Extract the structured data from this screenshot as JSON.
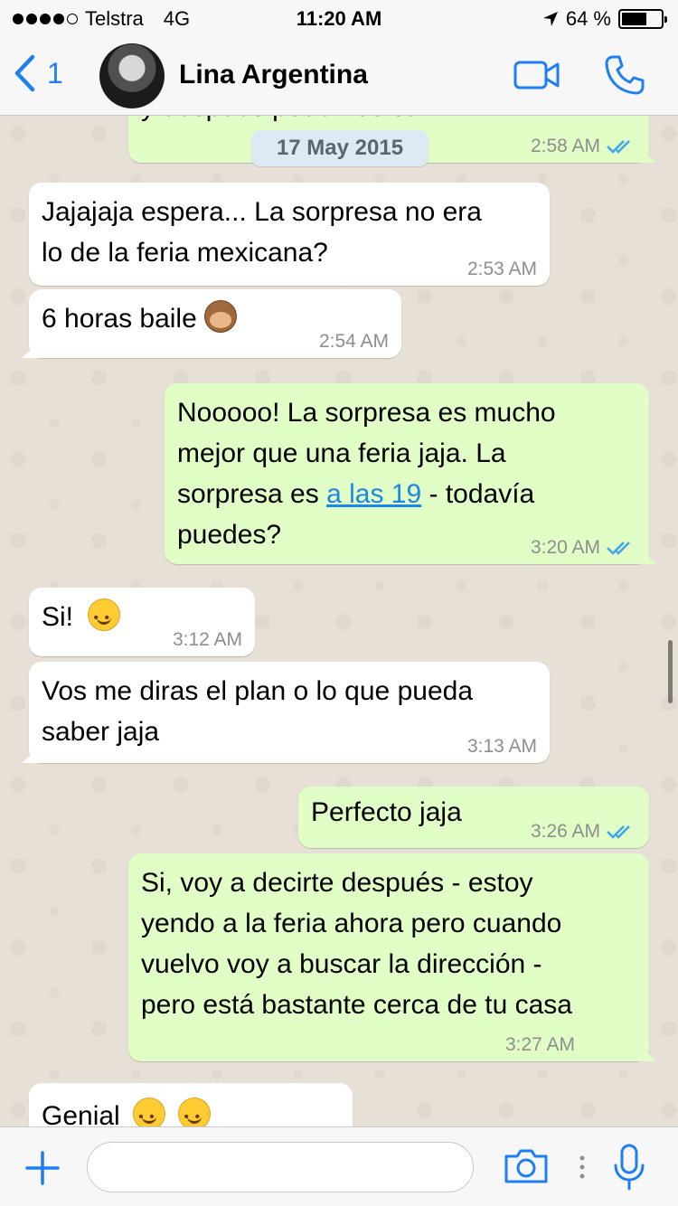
{
  "status_bar": {
    "carrier": "Telstra",
    "network": "4G",
    "time": "11:20 AM",
    "battery": "64 %",
    "battery_level": 0.64
  },
  "header": {
    "back_count": "1",
    "contact_name": "Lina Argentina",
    "icons": [
      "back-chevron-icon",
      "avatar",
      "video-camera-icon",
      "phone-icon"
    ]
  },
  "chat": {
    "date_pill": "17 May 2015",
    "messages": [
      {
        "direction": "out",
        "text": "y despues podemos salir",
        "time": "2:58 AM",
        "read": true
      },
      {
        "direction": "in",
        "lines": [
          "Jajajaja espera... La sorpresa no era",
          "lo de la feria mexicana?"
        ],
        "time": "2:53 AM"
      },
      {
        "direction": "in",
        "text": "6 horas baile",
        "emoji": "see-no-evil-monkey",
        "time": "2:54 AM"
      },
      {
        "direction": "out",
        "lines": [
          "Nooooo! La sorpresa es mucho",
          "mejor que una feria jaja. La"
        ],
        "line3_before": "sorpresa es ",
        "line3_link": "a las 19",
        "line3_after": " - todavía",
        "line4": "puedes?",
        "time": "3:20 AM",
        "read": true
      },
      {
        "direction": "in",
        "text": "Si!",
        "emoji": "smiling-face",
        "time": "3:12 AM"
      },
      {
        "direction": "in",
        "lines": [
          "Vos me diras el plan o lo que pueda",
          "saber jaja"
        ],
        "time": "3:13 AM"
      },
      {
        "direction": "out",
        "text": "Perfecto jaja",
        "time": "3:26 AM",
        "read": true
      },
      {
        "direction": "out",
        "lines": [
          "Si, voy a decirte después - estoy",
          "yendo a la feria ahora pero cuando",
          "vuelvo voy a buscar la dirección -",
          "pero está bastante cerca de tu casa"
        ],
        "time": "3:27 AM"
      },
      {
        "direction": "in",
        "text": "Genial",
        "emoji": "smiling-face x2"
      }
    ]
  },
  "input_bar": {
    "placeholder": "",
    "icons": [
      "plus-icon",
      "camera-icon",
      "more-dots-icon",
      "microphone-icon"
    ]
  },
  "colors": {
    "accent": "#1d7ff3",
    "incoming_bubble": "#ffffff",
    "outgoing_bubble": "#e1fec6",
    "chat_background": "#e6e0d6",
    "read_ticks": "#3ea6ea",
    "date_pill": "#dde9f5"
  }
}
